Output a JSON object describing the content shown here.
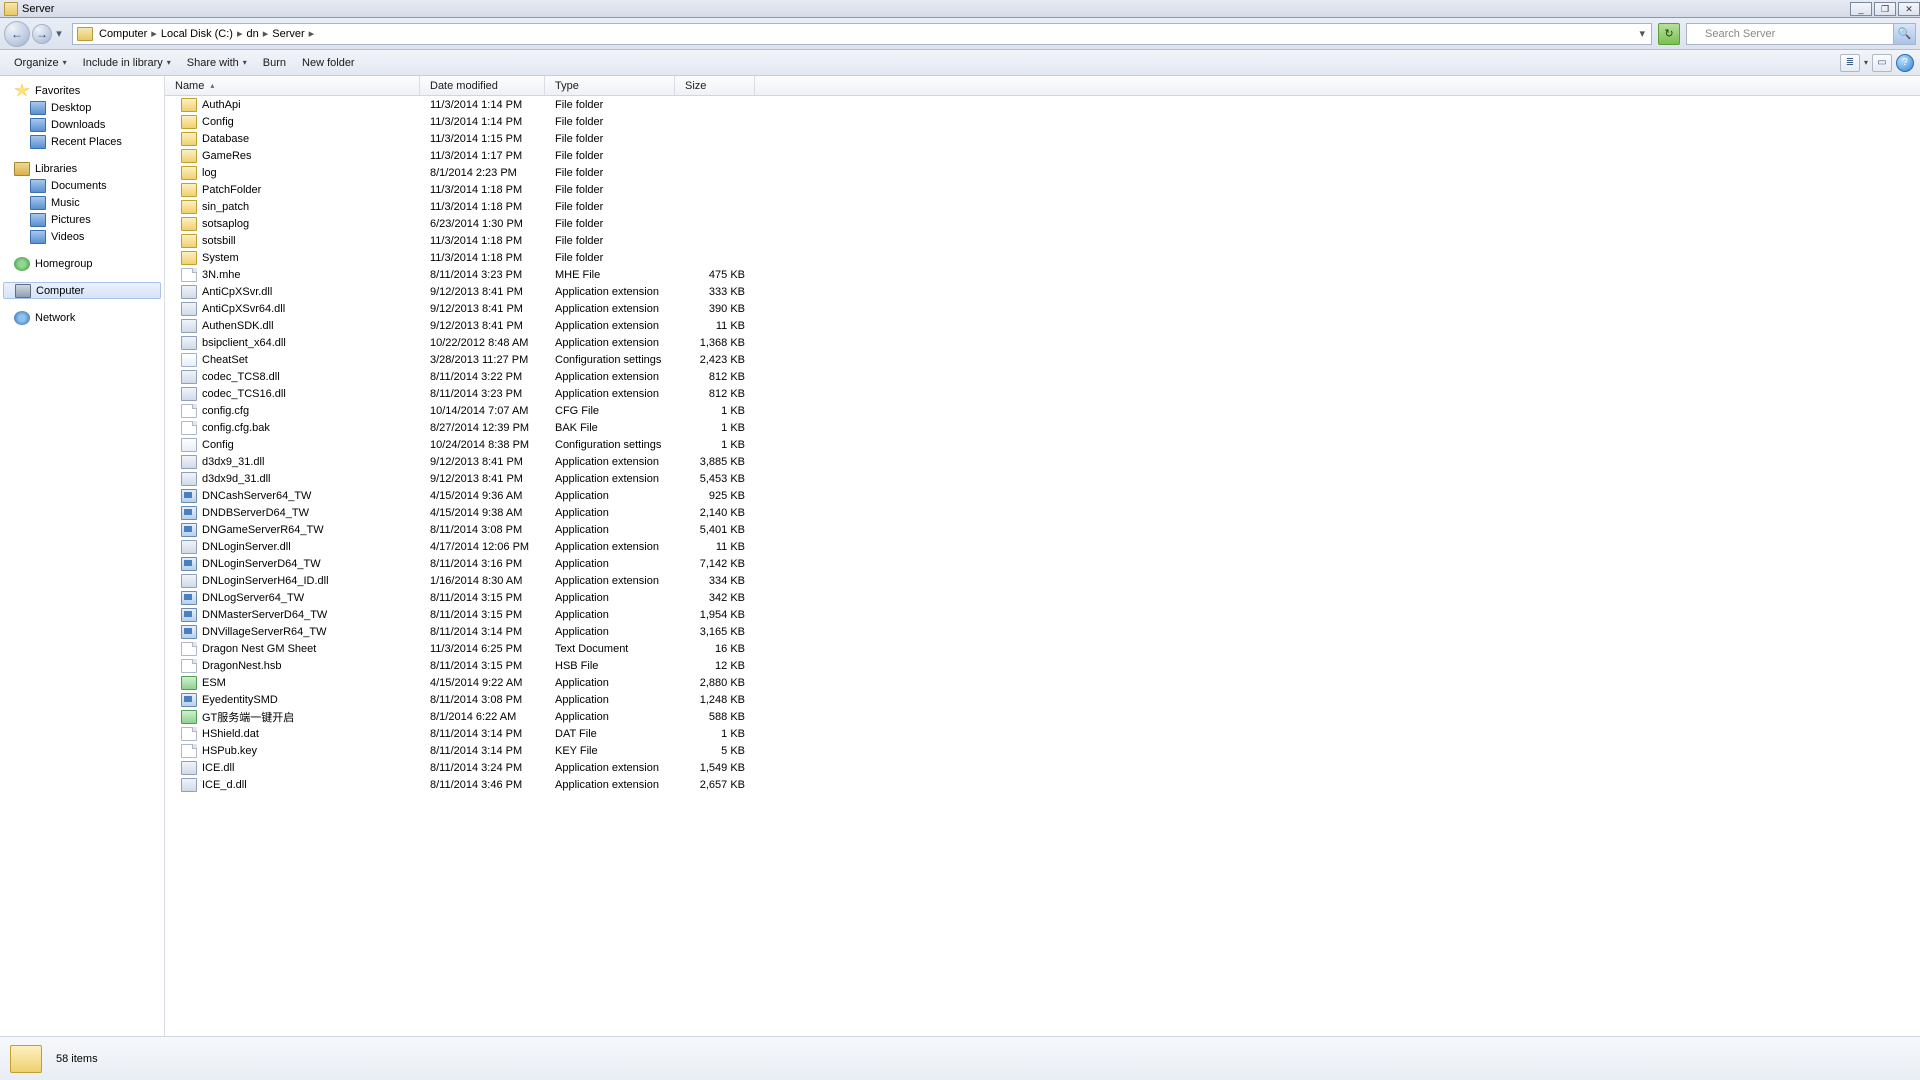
{
  "window": {
    "title": "Server"
  },
  "winbtns": {
    "min": "_",
    "max": "☐",
    "restore": "❐",
    "close": "✕"
  },
  "nav": {
    "back": "←",
    "fwd": "→",
    "drop": "▾",
    "refresh": "↻",
    "end_drop": "▾"
  },
  "breadcrumb": [
    {
      "label": "Computer"
    },
    {
      "label": "Local Disk (C:)"
    },
    {
      "label": "dn"
    },
    {
      "label": "Server"
    }
  ],
  "search": {
    "placeholder": "Search Server",
    "icon": "🔍"
  },
  "toolbar": {
    "organize": "Organize",
    "include": "Include in library",
    "share": "Share with",
    "burn": "Burn",
    "newfolder": "New folder",
    "dd": "▾",
    "views_icon": "≣",
    "preview_icon": "▭",
    "help_icon": "?"
  },
  "navpane": {
    "favorites": "Favorites",
    "desktop": "Desktop",
    "downloads": "Downloads",
    "recent": "Recent Places",
    "libraries": "Libraries",
    "documents": "Documents",
    "music": "Music",
    "pictures": "Pictures",
    "videos": "Videos",
    "homegroup": "Homegroup",
    "computer": "Computer",
    "network": "Network"
  },
  "columns": {
    "name": "Name",
    "date": "Date modified",
    "type": "Type",
    "size": "Size",
    "sort_asc": "▴"
  },
  "files": [
    {
      "icon": "folder",
      "name": "AuthApi",
      "date": "11/3/2014 1:14 PM",
      "type": "File folder",
      "size": ""
    },
    {
      "icon": "folder",
      "name": "Config",
      "date": "11/3/2014 1:14 PM",
      "type": "File folder",
      "size": ""
    },
    {
      "icon": "folder",
      "name": "Database",
      "date": "11/3/2014 1:15 PM",
      "type": "File folder",
      "size": ""
    },
    {
      "icon": "folder",
      "name": "GameRes",
      "date": "11/3/2014 1:17 PM",
      "type": "File folder",
      "size": ""
    },
    {
      "icon": "folder",
      "name": "log",
      "date": "8/1/2014 2:23 PM",
      "type": "File folder",
      "size": ""
    },
    {
      "icon": "folder",
      "name": "PatchFolder",
      "date": "11/3/2014 1:18 PM",
      "type": "File folder",
      "size": ""
    },
    {
      "icon": "folder",
      "name": "sin_patch",
      "date": "11/3/2014 1:18 PM",
      "type": "File folder",
      "size": ""
    },
    {
      "icon": "folder",
      "name": "sotsaplog",
      "date": "6/23/2014 1:30 PM",
      "type": "File folder",
      "size": ""
    },
    {
      "icon": "folder",
      "name": "sotsbill",
      "date": "11/3/2014 1:18 PM",
      "type": "File folder",
      "size": ""
    },
    {
      "icon": "folder",
      "name": "System",
      "date": "11/3/2014 1:18 PM",
      "type": "File folder",
      "size": ""
    },
    {
      "icon": "file",
      "name": "3N.mhe",
      "date": "8/11/2014 3:23 PM",
      "type": "MHE File",
      "size": "475 KB"
    },
    {
      "icon": "dll",
      "name": "AntiCpXSvr.dll",
      "date": "9/12/2013 8:41 PM",
      "type": "Application extension",
      "size": "333 KB"
    },
    {
      "icon": "dll",
      "name": "AntiCpXSvr64.dll",
      "date": "9/12/2013 8:41 PM",
      "type": "Application extension",
      "size": "390 KB"
    },
    {
      "icon": "dll",
      "name": "AuthenSDK.dll",
      "date": "9/12/2013 8:41 PM",
      "type": "Application extension",
      "size": "11 KB"
    },
    {
      "icon": "dll",
      "name": "bsipclient_x64.dll",
      "date": "10/22/2012 8:48 AM",
      "type": "Application extension",
      "size": "1,368 KB"
    },
    {
      "icon": "cfg",
      "name": "CheatSet",
      "date": "3/28/2013 11:27 PM",
      "type": "Configuration settings",
      "size": "2,423 KB"
    },
    {
      "icon": "dll",
      "name": "codec_TCS8.dll",
      "date": "8/11/2014 3:22 PM",
      "type": "Application extension",
      "size": "812 KB"
    },
    {
      "icon": "dll",
      "name": "codec_TCS16.dll",
      "date": "8/11/2014 3:23 PM",
      "type": "Application extension",
      "size": "812 KB"
    },
    {
      "icon": "file",
      "name": "config.cfg",
      "date": "10/14/2014 7:07 AM",
      "type": "CFG File",
      "size": "1 KB"
    },
    {
      "icon": "file",
      "name": "config.cfg.bak",
      "date": "8/27/2014 12:39 PM",
      "type": "BAK File",
      "size": "1 KB"
    },
    {
      "icon": "cfg",
      "name": "Config",
      "date": "10/24/2014 8:38 PM",
      "type": "Configuration settings",
      "size": "1 KB"
    },
    {
      "icon": "dll",
      "name": "d3dx9_31.dll",
      "date": "9/12/2013 8:41 PM",
      "type": "Application extension",
      "size": "3,885 KB"
    },
    {
      "icon": "dll",
      "name": "d3dx9d_31.dll",
      "date": "9/12/2013 8:41 PM",
      "type": "Application extension",
      "size": "5,453 KB"
    },
    {
      "icon": "exe",
      "name": "DNCashServer64_TW",
      "date": "4/15/2014 9:36 AM",
      "type": "Application",
      "size": "925 KB"
    },
    {
      "icon": "exe",
      "name": "DNDBServerD64_TW",
      "date": "4/15/2014 9:38 AM",
      "type": "Application",
      "size": "2,140 KB"
    },
    {
      "icon": "exe",
      "name": "DNGameServerR64_TW",
      "date": "8/11/2014 3:08 PM",
      "type": "Application",
      "size": "5,401 KB"
    },
    {
      "icon": "dll",
      "name": "DNLoginServer.dll",
      "date": "4/17/2014 12:06 PM",
      "type": "Application extension",
      "size": "11 KB"
    },
    {
      "icon": "exe",
      "name": "DNLoginServerD64_TW",
      "date": "8/11/2014 3:16 PM",
      "type": "Application",
      "size": "7,142 KB"
    },
    {
      "icon": "dll",
      "name": "DNLoginServerH64_ID.dll",
      "date": "1/16/2014 8:30 AM",
      "type": "Application extension",
      "size": "334 KB"
    },
    {
      "icon": "exe",
      "name": "DNLogServer64_TW",
      "date": "8/11/2014 3:15 PM",
      "type": "Application",
      "size": "342 KB"
    },
    {
      "icon": "exe",
      "name": "DNMasterServerD64_TW",
      "date": "8/11/2014 3:15 PM",
      "type": "Application",
      "size": "1,954 KB"
    },
    {
      "icon": "exe",
      "name": "DNVillageServerR64_TW",
      "date": "8/11/2014 3:14 PM",
      "type": "Application",
      "size": "3,165 KB"
    },
    {
      "icon": "file",
      "name": "Dragon Nest GM Sheet",
      "date": "11/3/2014 6:25 PM",
      "type": "Text Document",
      "size": "16 KB"
    },
    {
      "icon": "file",
      "name": "DragonNest.hsb",
      "date": "8/11/2014 3:15 PM",
      "type": "HSB File",
      "size": "12 KB"
    },
    {
      "icon": "app",
      "name": "ESM",
      "date": "4/15/2014 9:22 AM",
      "type": "Application",
      "size": "2,880 KB"
    },
    {
      "icon": "exe",
      "name": "EyedentitySMD",
      "date": "8/11/2014 3:08 PM",
      "type": "Application",
      "size": "1,248 KB"
    },
    {
      "icon": "app",
      "name": "GT服务端一键开启",
      "date": "8/1/2014 6:22 AM",
      "type": "Application",
      "size": "588 KB"
    },
    {
      "icon": "file",
      "name": "HShield.dat",
      "date": "8/11/2014 3:14 PM",
      "type": "DAT File",
      "size": "1 KB"
    },
    {
      "icon": "file",
      "name": "HSPub.key",
      "date": "8/11/2014 3:14 PM",
      "type": "KEY File",
      "size": "5 KB"
    },
    {
      "icon": "dll",
      "name": "ICE.dll",
      "date": "8/11/2014 3:24 PM",
      "type": "Application extension",
      "size": "1,549 KB"
    },
    {
      "icon": "dll",
      "name": "ICE_d.dll",
      "date": "8/11/2014 3:46 PM",
      "type": "Application extension",
      "size": "2,657 KB"
    }
  ],
  "status": {
    "items": "58 items"
  }
}
